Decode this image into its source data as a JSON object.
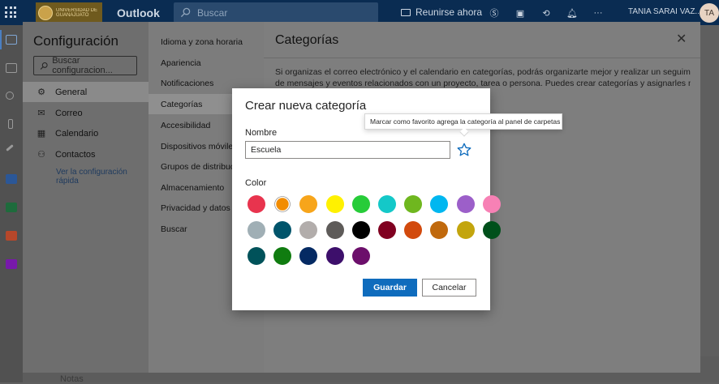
{
  "topbar": {
    "org_logo_text": "UNIVERSIDAD DE GUANAJUATO",
    "app_name": "Outlook",
    "search_placeholder": "Buscar",
    "meet_now": "Reunirse ahora",
    "user_name": "TANIA SARAI VAZ...",
    "avatar_initials": "TA",
    "icons": [
      "skype-icon",
      "office-icon",
      "sync-icon",
      "bell-icon",
      "more-icon"
    ]
  },
  "settings": {
    "title": "Configuración",
    "search_placeholder": "Buscar configuracion...",
    "nav": [
      {
        "label": "General",
        "icon": "gear-icon",
        "selected": true
      },
      {
        "label": "Correo",
        "icon": "mail-icon",
        "selected": false
      },
      {
        "label": "Calendario",
        "icon": "calendar-icon",
        "selected": false
      },
      {
        "label": "Contactos",
        "icon": "people-icon",
        "selected": false
      }
    ],
    "quick_settings": "Ver la configuración rápida",
    "subnav": [
      {
        "label": "Idioma y zona horaria",
        "selected": false
      },
      {
        "label": "Apariencia",
        "selected": false
      },
      {
        "label": "Notificaciones",
        "selected": false
      },
      {
        "label": "Categorías",
        "selected": true
      },
      {
        "label": "Accesibilidad",
        "selected": false
      },
      {
        "label": "Dispositivos móviles",
        "selected": false
      },
      {
        "label": "Grupos de distribución",
        "selected": false
      },
      {
        "label": "Almacenamiento",
        "selected": false
      },
      {
        "label": "Privacidad y datos",
        "selected": false
      },
      {
        "label": "Buscar",
        "selected": false
      }
    ],
    "content_title": "Categorías",
    "content_text_1": "Si organizas el correo electrónico y el calendario en categorías, podrás organizarte mejor y realizar un seguimiento",
    "content_text_2": "de mensajes y eventos relacionados con un proyecto, tarea o persona. Puedes crear categorías y asignarles nombres"
  },
  "modal": {
    "title": "Crear nueva categoría",
    "name_label": "Nombre",
    "name_value": "Escuela",
    "color_label": "Color",
    "save_label": "Guardar",
    "cancel_label": "Cancelar",
    "tooltip": "Marcar como favorito agrega la categoría al panel de carpetas",
    "selected_color": "#f28c00",
    "colors": [
      "#e8344e",
      "#f28c00",
      "#f7a51b",
      "#fff100",
      "#27cc39",
      "#14c8c8",
      "#6fb71f",
      "#00b7f0",
      "#9c5fc9",
      "#f781b5",
      "#a0afb5",
      "#00546b",
      "#b2adab",
      "#5e5b59",
      "#000000",
      "#800020",
      "#d24a0d",
      "#c0690d",
      "#c3a50d",
      "#00501b",
      "#00525a",
      "#107c10",
      "#052a63",
      "#3d0f6b",
      "#6c0f6b"
    ]
  },
  "behind": {
    "label": "Notas"
  }
}
